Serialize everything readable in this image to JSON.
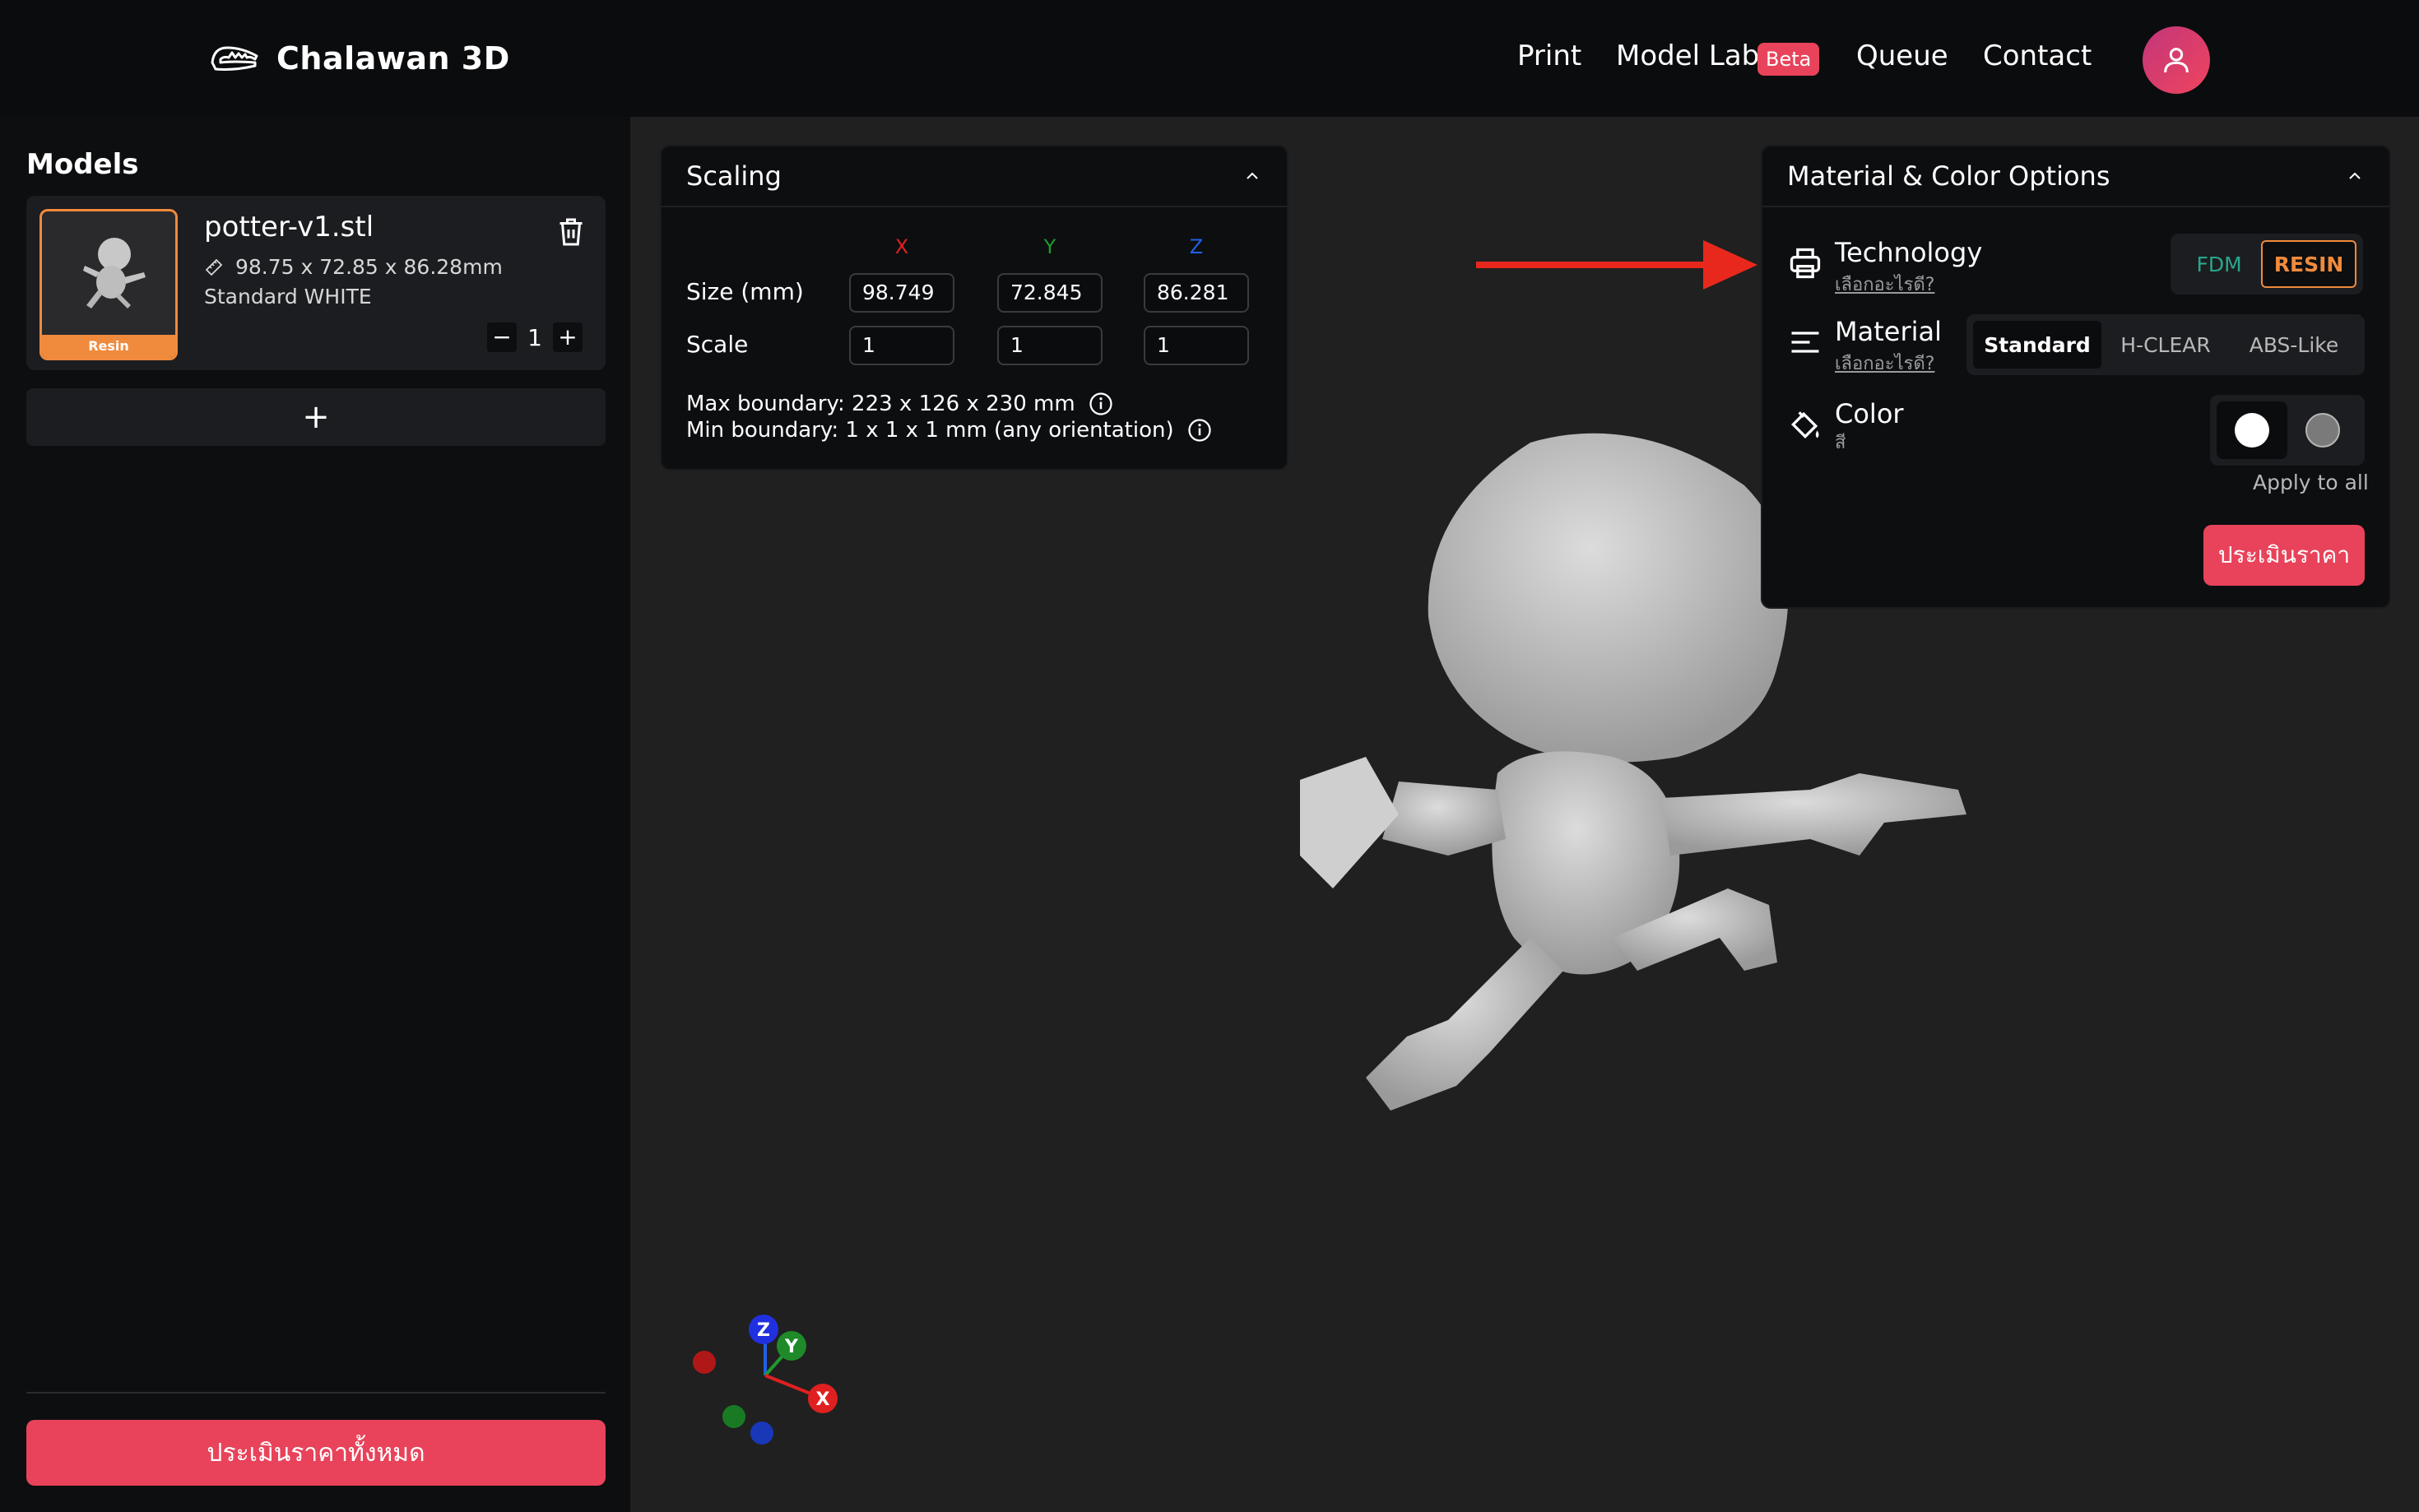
{
  "header": {
    "brand": "Chalawan 3D",
    "nav": [
      {
        "label": "Print"
      },
      {
        "label": "Model Lab"
      },
      {
        "label": "Queue"
      },
      {
        "label": "Contact"
      }
    ],
    "beta_badge": "Beta"
  },
  "sidebar": {
    "title": "Models",
    "models": [
      {
        "name": "potter-v1.stl",
        "dimensions": "98.75 x 72.85 x 86.28mm",
        "material": "Standard WHITE",
        "badge": "Resin",
        "quantity": "1"
      }
    ],
    "add_label": "+",
    "estimate_all": "ประเมินราคาทั้งหมด"
  },
  "scaling": {
    "title": "Scaling",
    "axes": [
      "X",
      "Y",
      "Z"
    ],
    "size_label": "Size (mm)",
    "scale_label": "Scale",
    "size_values": [
      "98.749",
      "72.845",
      "86.281"
    ],
    "scale_values": [
      "1",
      "1",
      "1"
    ],
    "max_boundary": "Max boundary: 223 x 126 x 230 mm",
    "min_boundary": "Min boundary: 1 x 1 x 1 mm (any orientation)"
  },
  "material_panel": {
    "title": "Material & Color Options",
    "technology": {
      "title": "Technology",
      "help": "เลือกอะไรดี?",
      "options": [
        "FDM",
        "RESIN"
      ],
      "selected": "RESIN"
    },
    "material": {
      "title": "Material",
      "help": "เลือกอะไรดี?",
      "options": [
        "Standard",
        "H-CLEAR",
        "ABS-Like"
      ],
      "selected": "Standard"
    },
    "color": {
      "title": "Color",
      "sub": "สี",
      "swatches": [
        "#ffffff",
        "#7a7a7a"
      ]
    },
    "apply_all": "Apply to all",
    "estimate": "ประเมินราคา"
  },
  "gizmo": {
    "x": "X",
    "y": "Y",
    "z": "Z"
  },
  "colors": {
    "accent": "#e8435a",
    "resin": "#f08a3c",
    "fdm": "#2aa58c",
    "axis_x": "#e02020",
    "axis_y": "#1f9a2e",
    "axis_z": "#2060e8"
  }
}
